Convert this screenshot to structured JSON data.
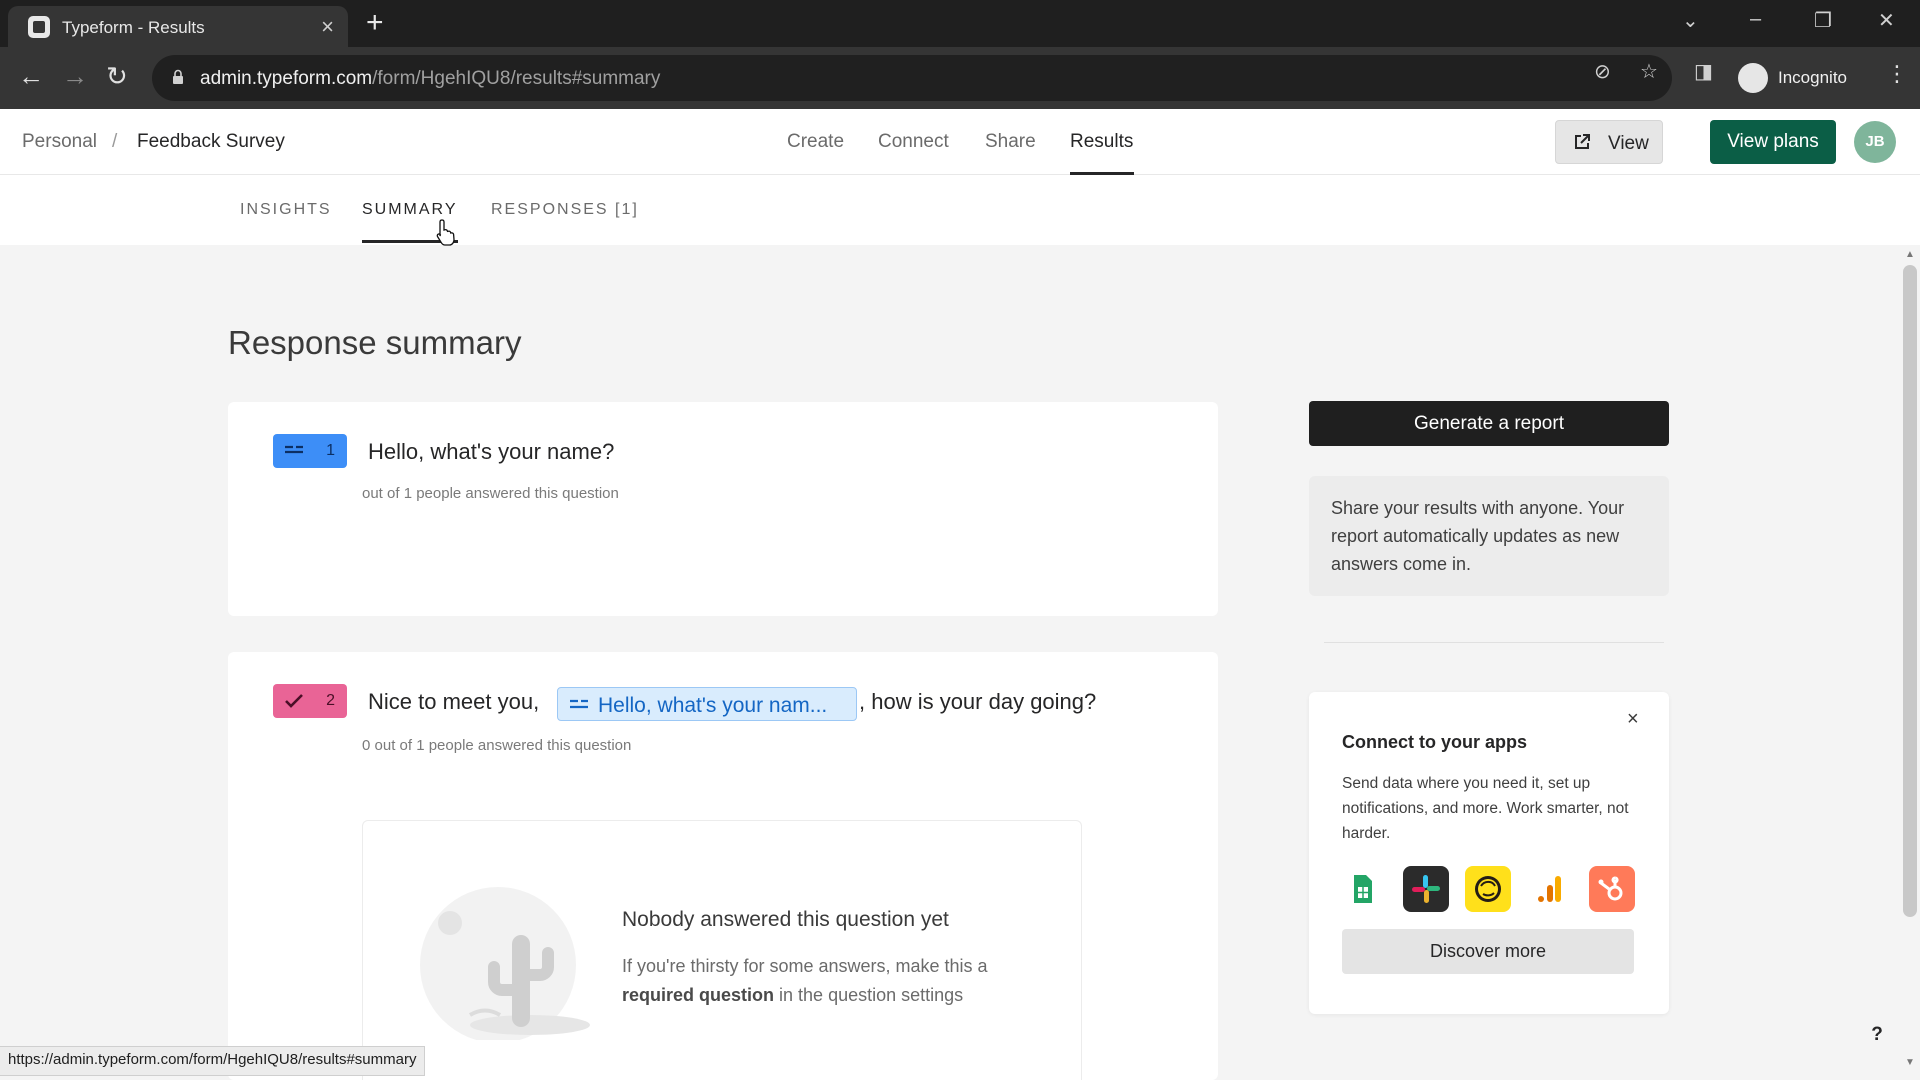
{
  "browser": {
    "tab_title": "Typeform - Results",
    "url_host": "admin.typeform.com",
    "url_path": "/form/HgehIQU8/results#summary",
    "profile_label": "Incognito",
    "status_url": "https://admin.typeform.com/form/HgehIQU8/results#summary"
  },
  "header": {
    "breadcrumb": {
      "root": "Personal",
      "separator": "/",
      "current": "Feedback Survey"
    },
    "nav": [
      {
        "label": "Create"
      },
      {
        "label": "Connect"
      },
      {
        "label": "Share"
      },
      {
        "label": "Results",
        "active": true
      }
    ],
    "view_label": "View",
    "plans_label": "View plans",
    "user_initials": "JB"
  },
  "subtabs": [
    {
      "label": "INSIGHTS"
    },
    {
      "label": "SUMMARY",
      "active": true
    },
    {
      "label": "RESPONSES [1]"
    }
  ],
  "main": {
    "title": "Response summary",
    "questions": [
      {
        "number": "1",
        "icon": "short-text-icon",
        "badge_color": "#3d8ef7",
        "text": "Hello, what's your name?",
        "answered": "out of 1 people answered this question"
      },
      {
        "number": "2",
        "icon": "checkmark-icon",
        "badge_color": "#e96496",
        "text_before": "Nice to meet you,",
        "recall_label": "Hello, what's your nam...",
        "text_after": ", how is your day going?",
        "answered": "0 out of 1 people answered this question",
        "empty": {
          "title": "Nobody answered this question yet",
          "desc_pre": "If you're thirsty for some answers, make this a",
          "desc_bold": "required question",
          "desc_post": "in the question settings"
        }
      }
    ]
  },
  "sidebar": {
    "generate_label": "Generate a report",
    "report_info": "Share your results with anyone. Your report automatically updates as new answers come in.",
    "apps": {
      "title": "Connect to your apps",
      "desc": "Send data where you need it, set up notifications, and more. Work smarter, not harder.",
      "icons": [
        {
          "name": "google-sheets-icon",
          "color": "#ffffff"
        },
        {
          "name": "slack-icon",
          "color": "#2b2b2b"
        },
        {
          "name": "mailchimp-icon",
          "color": "#ffe01b"
        },
        {
          "name": "google-analytics-icon",
          "color": "#ffffff"
        },
        {
          "name": "hubspot-icon",
          "color": "#ff7a59"
        }
      ],
      "discover_label": "Discover more"
    }
  },
  "help_label": "?"
}
